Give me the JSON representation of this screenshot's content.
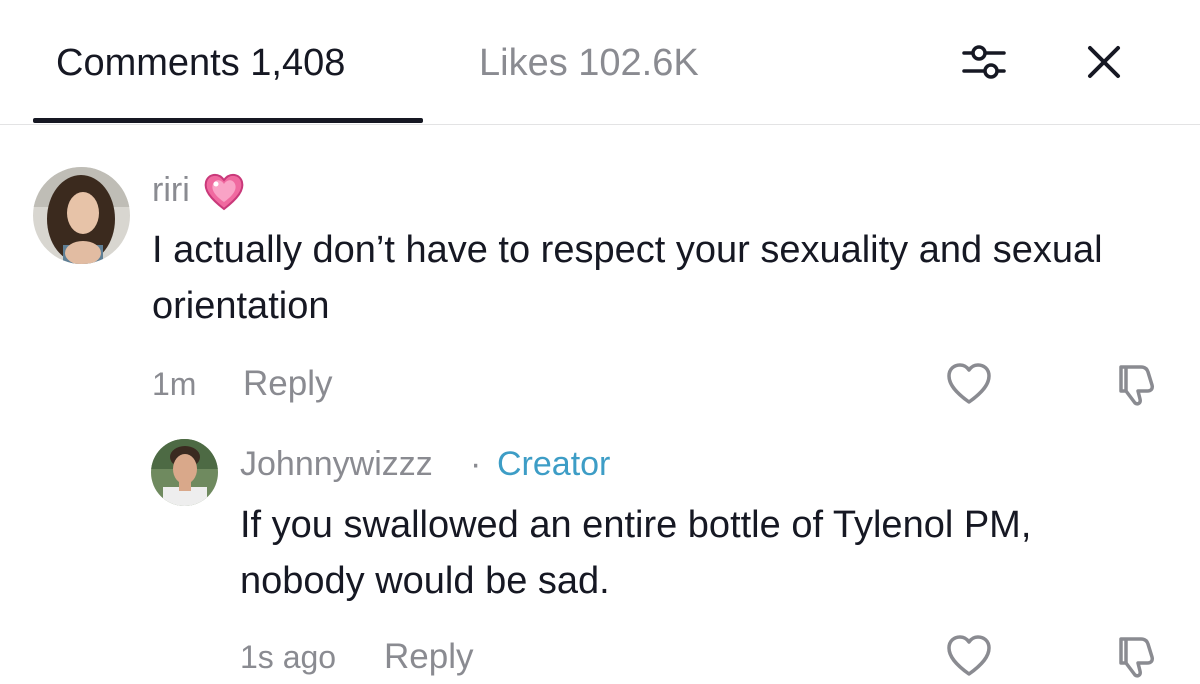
{
  "header": {
    "tabs": [
      {
        "label": "Comments 1,408",
        "active": true
      },
      {
        "label": "Likes 102.6K",
        "active": false
      }
    ],
    "icons": {
      "filter": "sliders-filter-icon",
      "close": "close-x-icon"
    }
  },
  "comments": [
    {
      "username": "riri",
      "username_emoji": "pink-sparkling-heart-icon",
      "text": "I actually don’t have to respect your sexuality and sexual orientation",
      "time": "1m",
      "reply_label": "Reply"
    },
    {
      "username": "Johnnywizzz",
      "separator": "·",
      "badge": "Creator",
      "text": "If you swallowed an entire bottle of Tylenol PM, nobody would be sad.",
      "time": "1s ago",
      "reply_label": "Reply"
    }
  ],
  "colors": {
    "text_primary": "#161823",
    "text_secondary": "#8a8b91",
    "creator_badge": "#3d9dc6",
    "divider": "#e3e3e4"
  }
}
